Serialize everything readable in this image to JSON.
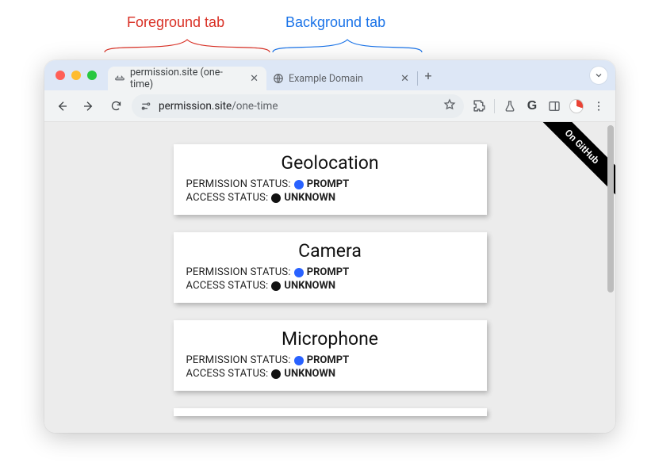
{
  "annotations": {
    "foreground": "Foreground tab",
    "background": "Background tab"
  },
  "tabs": {
    "active": {
      "title": "permission.site (one-time)"
    },
    "inactive": {
      "title": "Example Domain"
    }
  },
  "omnibox": {
    "host": "permission.site",
    "path": "/one-time"
  },
  "ribbon": "On GitHub",
  "labels": {
    "permission": "PERMISSION STATUS:",
    "access": "ACCESS STATUS:"
  },
  "statuses": {
    "prompt": "PROMPT",
    "unknown": "UNKNOWN"
  },
  "cards": {
    "geolocation": "Geolocation",
    "camera": "Camera",
    "microphone": "Microphone"
  }
}
